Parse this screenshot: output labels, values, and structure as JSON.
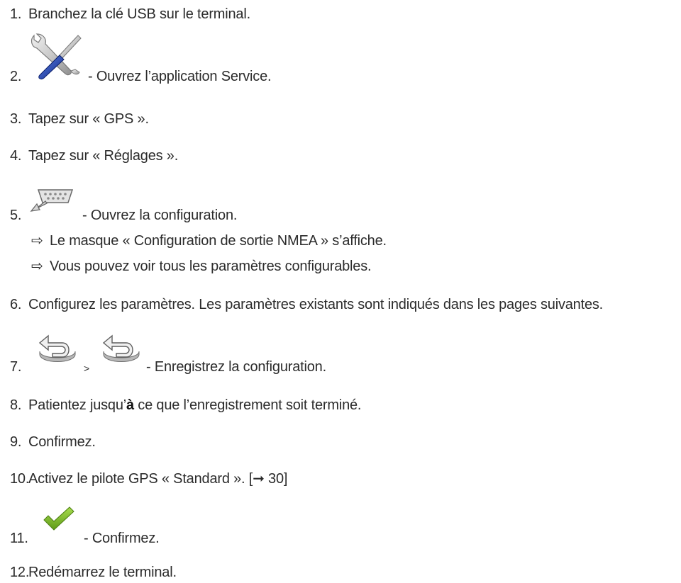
{
  "steps": [
    {
      "num": "1.",
      "text": "Branchez la clé USB sur le terminal."
    },
    {
      "num": "2.",
      "text": "- Ouvrez l’application Service.",
      "icon": "service-wrench-screwdriver-icon"
    },
    {
      "num": "3.",
      "text": "Tapez sur « GPS »."
    },
    {
      "num": "4.",
      "text": "Tapez sur « Réglages »."
    },
    {
      "num": "5.",
      "text": "- Ouvrez la configuration.",
      "icon": "serial-port-config-icon"
    },
    {
      "num": "6.",
      "text": "Configurez les paramètres. Les paramètres existants sont indiqués dans les pages suivantes."
    },
    {
      "num": "7.",
      "separator": ">",
      "text": "- Enregistrez la configuration.",
      "icon": "back-arrow-icon"
    },
    {
      "num": "8.",
      "text_before": "Patientez jusqu’",
      "text_bold": "à",
      "text_after": " ce que l’enregistrement soit terminé."
    },
    {
      "num": "9.",
      "text": "Confirmez."
    },
    {
      "num": "10.",
      "text": "Activez le pilote GPS « Standard ». [➞ 30]"
    },
    {
      "num": "11.",
      "text": "- Confirmez.",
      "icon": "checkmark-icon"
    },
    {
      "num": "12.",
      "text": "Redémarrez le terminal."
    }
  ],
  "results": [
    {
      "arrow": "⇨",
      "text": "Le masque « Configuration de sortie NMEA » s’affiche."
    },
    {
      "arrow": "⇨",
      "text": "Vous pouvez voir tous les paramètres configurables."
    }
  ],
  "colors": {
    "text": "#2b2b2b",
    "check_green": "#7ab829",
    "screwdriver_blue": "#1d3fa8"
  }
}
